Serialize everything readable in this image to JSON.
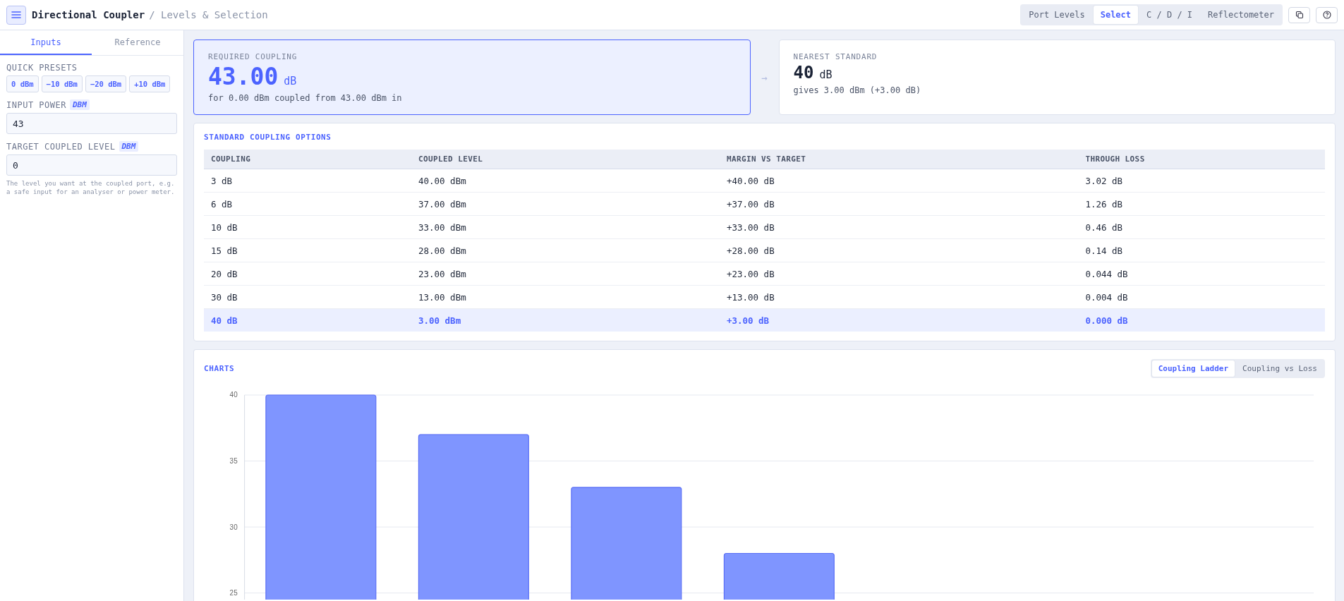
{
  "header": {
    "title": "Directional Coupler",
    "subtitle": "/ Levels & Selection",
    "mode_tabs": [
      {
        "label": "Port Levels",
        "selected": false
      },
      {
        "label": "Select",
        "selected": true
      },
      {
        "label": "C / D / I",
        "selected": false
      },
      {
        "label": "Reflectometer",
        "selected": false
      }
    ]
  },
  "sidebar": {
    "tabs": [
      {
        "label": "Inputs",
        "selected": true
      },
      {
        "label": "Reference",
        "selected": false
      }
    ],
    "presets_label": "QUICK PRESETS",
    "presets": [
      "0 dBm",
      "−10 dBm",
      "−20 dBm",
      "+10 dBm"
    ],
    "fields": [
      {
        "label": "INPUT POWER",
        "unit": "DBM",
        "value": "43"
      },
      {
        "label": "TARGET COUPLED LEVEL",
        "unit": "DBM",
        "value": "0",
        "hint": "The level you want at the coupled port, e.g. a safe input for an analyser or power meter."
      }
    ]
  },
  "required": {
    "label": "REQUIRED COUPLING",
    "value": "43.00",
    "unit": "dB",
    "note": "for 0.00 dBm coupled from 43.00 dBm in"
  },
  "arrow": "→",
  "nearest": {
    "label": "NEAREST STANDARD",
    "value": "40",
    "unit": "dB",
    "note": "gives 3.00 dBm (+3.00 dB)"
  },
  "options_table": {
    "title": "STANDARD COUPLING OPTIONS",
    "columns": [
      "COUPLING",
      "COUPLED LEVEL",
      "MARGIN VS TARGET",
      "THROUGH LOSS"
    ],
    "rows": [
      {
        "cells": [
          "3 dB",
          "40.00 dBm",
          "+40.00 dB",
          "3.02 dB"
        ],
        "selected": false
      },
      {
        "cells": [
          "6 dB",
          "37.00 dBm",
          "+37.00 dB",
          "1.26 dB"
        ],
        "selected": false
      },
      {
        "cells": [
          "10 dB",
          "33.00 dBm",
          "+33.00 dB",
          "0.46 dB"
        ],
        "selected": false
      },
      {
        "cells": [
          "15 dB",
          "28.00 dBm",
          "+28.00 dB",
          "0.14 dB"
        ],
        "selected": false
      },
      {
        "cells": [
          "20 dB",
          "23.00 dBm",
          "+23.00 dB",
          "0.044 dB"
        ],
        "selected": false
      },
      {
        "cells": [
          "30 dB",
          "13.00 dBm",
          "+13.00 dB",
          "0.004 dB"
        ],
        "selected": false
      },
      {
        "cells": [
          "40 dB",
          "3.00 dBm",
          "+3.00 dB",
          "0.000 dB"
        ],
        "selected": true
      }
    ]
  },
  "charts": {
    "title": "CHARTS",
    "tabs": [
      {
        "label": "Coupling Ladder",
        "selected": true
      },
      {
        "label": "Coupling vs Loss",
        "selected": false
      }
    ],
    "chart_data": {
      "type": "bar",
      "values": [
        40,
        37,
        33,
        28,
        null,
        null,
        null
      ],
      "ylim": [
        24.5,
        40
      ],
      "yticks": [
        25,
        30,
        35,
        40
      ],
      "grid": true
    }
  }
}
